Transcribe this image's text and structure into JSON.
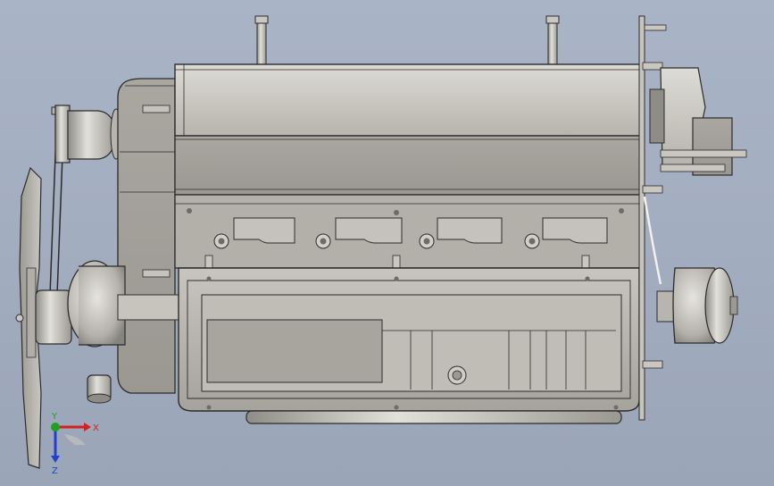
{
  "viewport": {
    "background_top": "#a9b4c6",
    "background_bottom": "#9aa5b7",
    "model": "engine-assembly"
  },
  "triad": {
    "x_label": "X",
    "y_label": "Y",
    "z_label": "Z",
    "x_color": "#d42020",
    "y_color": "#20a020",
    "z_color": "#2040d0"
  },
  "colors": {
    "metal_light": "#d4d2cb",
    "metal_mid": "#b3b1aa",
    "metal_dark": "#8e8c86",
    "edge": "#2b2b2b"
  }
}
